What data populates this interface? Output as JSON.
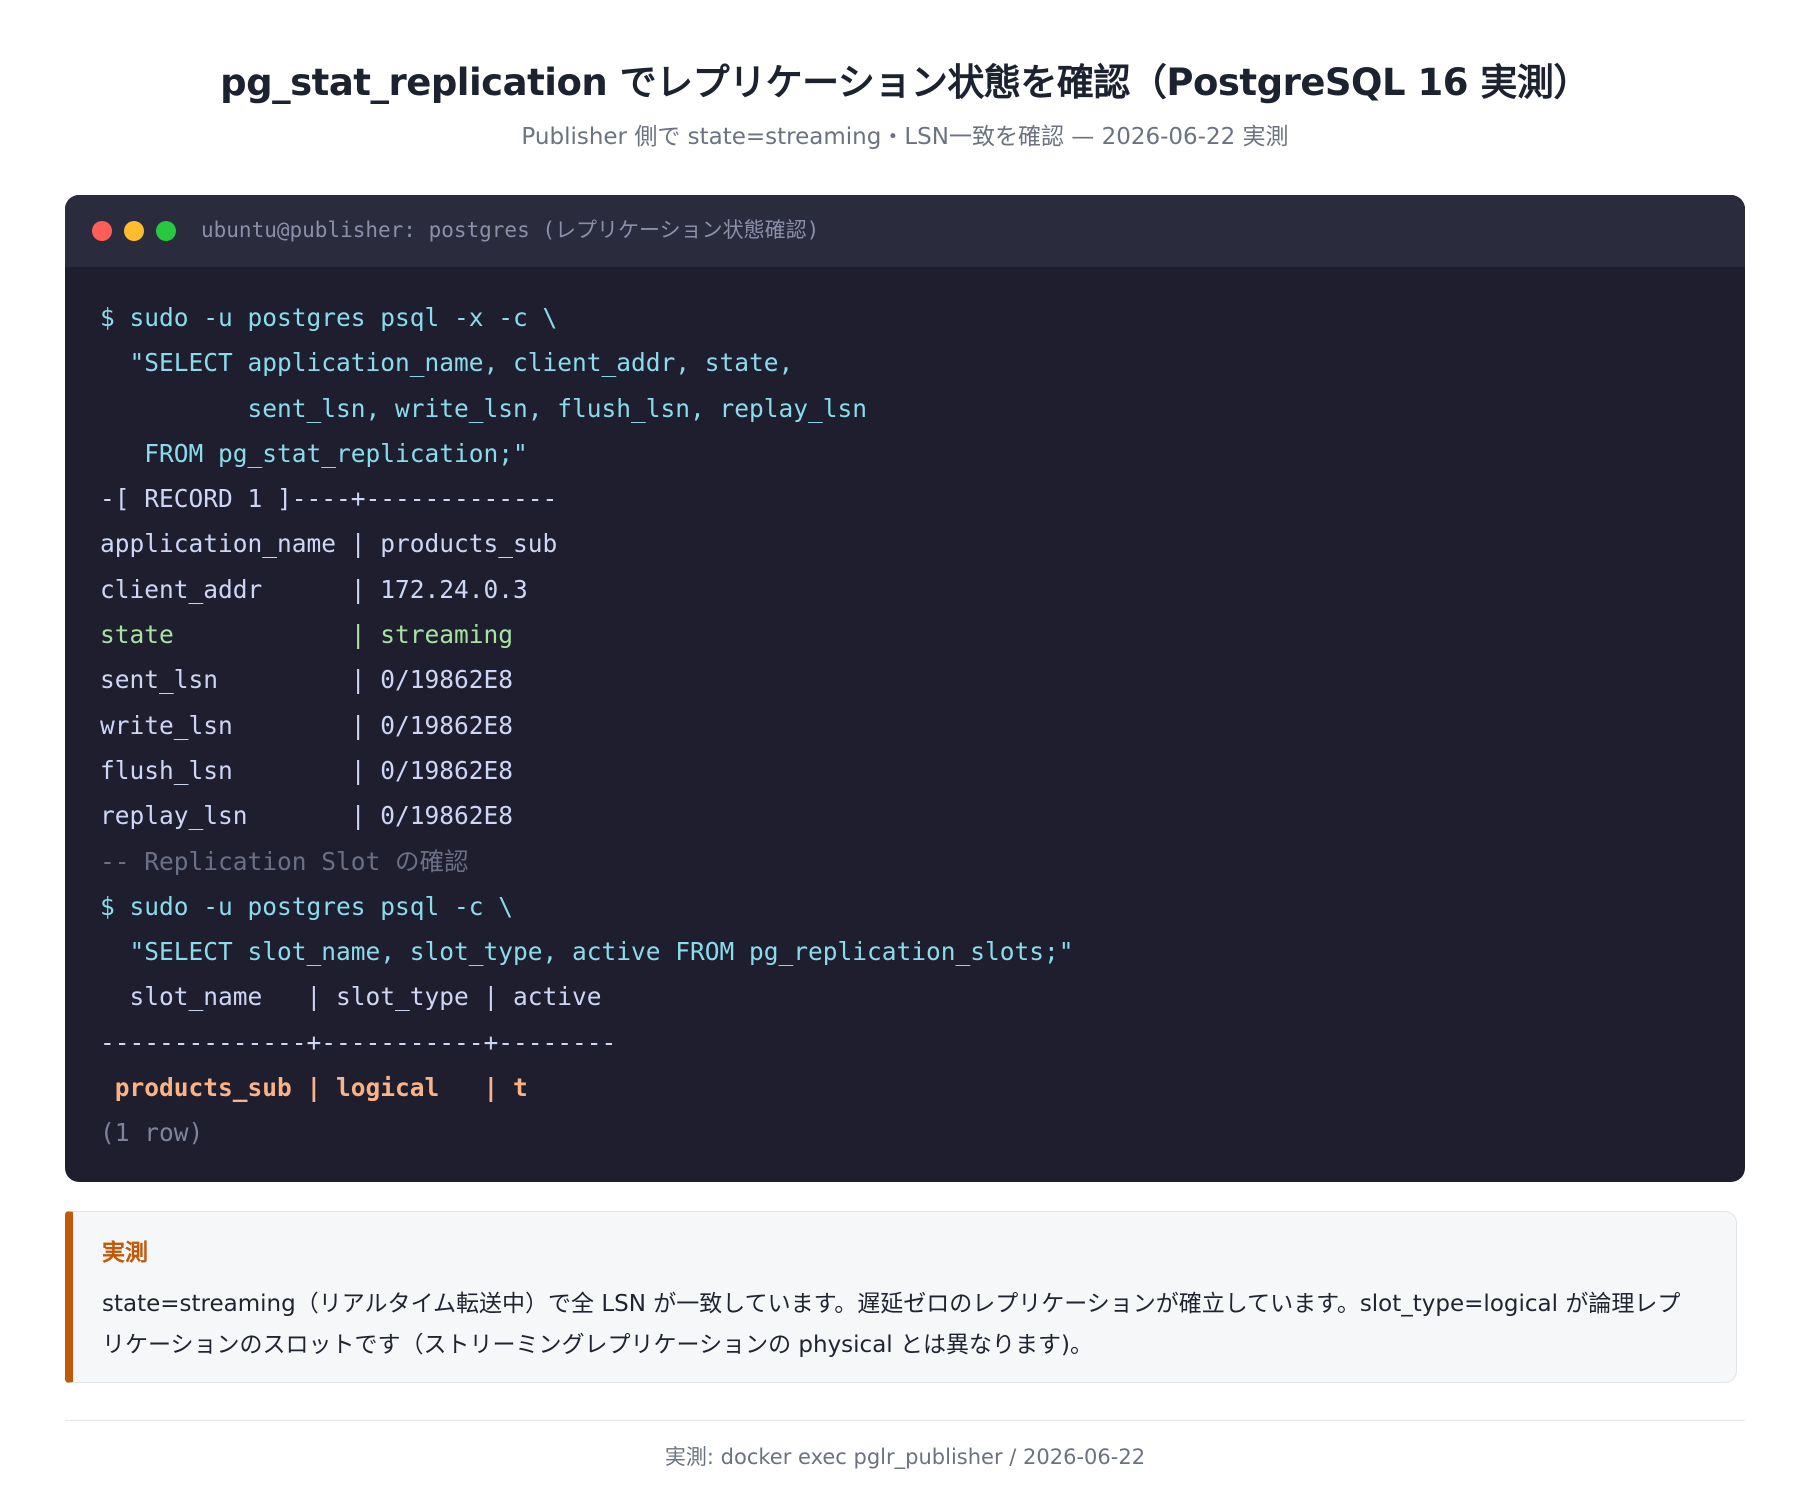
{
  "header": {
    "title": "pg_stat_replication でレプリケーション状態を確認（PostgreSQL 16 実測）",
    "subtitle": "Publisher 側で state=streaming・LSN一致を確認 — 2026-06-22 実測"
  },
  "terminal": {
    "title": "ubuntu@publisher: postgres (レプリケーション状態確認)",
    "lines": [
      {
        "text": "$ sudo -u postgres psql -x -c \\",
        "style": "cmd"
      },
      {
        "text": "  \"SELECT application_name, client_addr, state,",
        "style": "cmd"
      },
      {
        "text": "          sent_lsn, write_lsn, flush_lsn, replay_lsn",
        "style": "cmd"
      },
      {
        "text": "   FROM pg_stat_replication;\"",
        "style": "cmd"
      },
      {
        "text": "-[ RECORD 1 ]----+-------------",
        "style": "out"
      },
      {
        "text": "application_name | products_sub",
        "style": "out"
      },
      {
        "text": "client_addr      | 172.24.0.3",
        "style": "out"
      },
      {
        "text": "state            | streaming",
        "style": "ok"
      },
      {
        "text": "sent_lsn         | 0/19862E8",
        "style": "out"
      },
      {
        "text": "write_lsn        | 0/19862E8",
        "style": "out"
      },
      {
        "text": "flush_lsn        | 0/19862E8",
        "style": "out"
      },
      {
        "text": "replay_lsn       | 0/19862E8",
        "style": "out"
      },
      {
        "text": "-- Replication Slot の確認",
        "style": "cmt"
      },
      {
        "text": "$ sudo -u postgres psql -c \\",
        "style": "cmd"
      },
      {
        "text": "  \"SELECT slot_name, slot_type, active FROM pg_replication_slots;\"",
        "style": "cmd"
      },
      {
        "text": "  slot_name   | slot_type | active",
        "style": "out"
      },
      {
        "text": "--------------+-----------+--------",
        "style": "out"
      },
      {
        "text": " products_sub | logical   | t",
        "style": "hl"
      },
      {
        "text": "(1 row)",
        "style": "dim"
      }
    ]
  },
  "note": {
    "heading": "実測",
    "body": "state=streaming（リアルタイム転送中）で全 LSN が一致しています。遅延ゼロのレプリケーションが確立しています。slot_type=logical が論理レプリケーションのスロットです（ストリーミングレプリケーションの physical とは異なります)。"
  },
  "footer": {
    "text": "実測: docker exec pglr_publisher / 2026-06-22"
  },
  "colors": {
    "accent": "#c2590a",
    "terminal_bg": "#1e1e2e",
    "terminal_bar": "#2a2b3d",
    "command": "#89dceb",
    "output": "#cdd6f4",
    "success": "#a6e3a1",
    "comment": "#6c7086",
    "highlight": "#fab387"
  }
}
